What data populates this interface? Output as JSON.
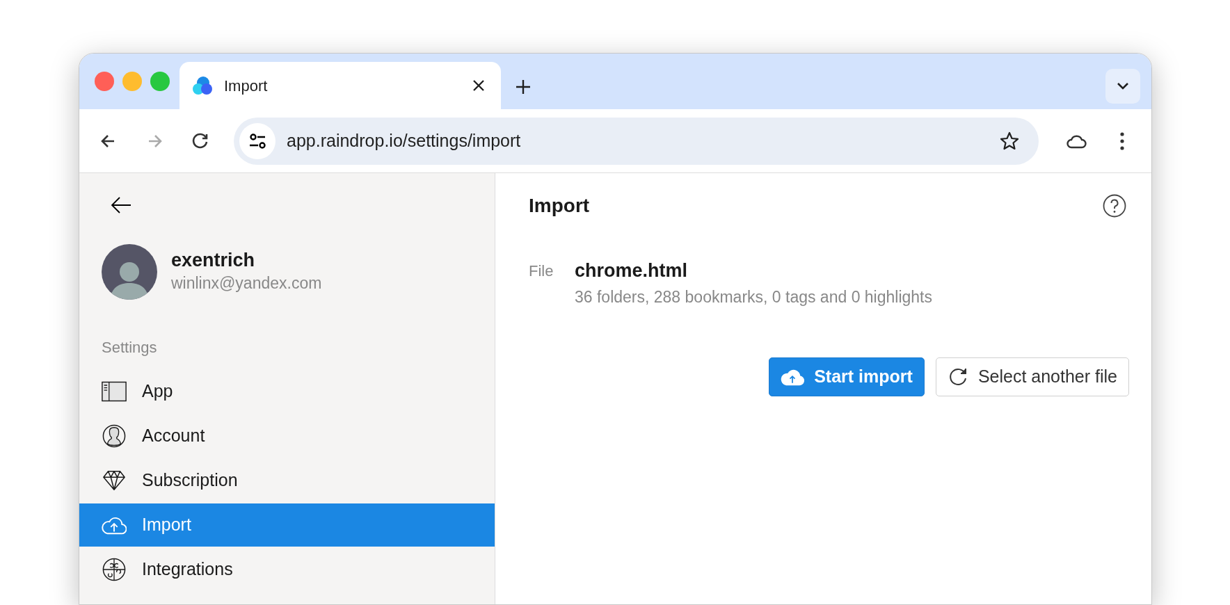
{
  "browser": {
    "tabs": [
      {
        "title": "Import",
        "selected": true
      }
    ],
    "nav_buttons": [
      {
        "kind": "back",
        "disabled": false
      },
      {
        "kind": "forward",
        "disabled": true
      },
      {
        "kind": "reload",
        "disabled": false
      }
    ],
    "address_bar": {
      "url": "app.raindrop.io/settings/import"
    }
  },
  "sidebar": {
    "user": {
      "name": "exentrich",
      "email": "winlinx@yandex.com"
    },
    "section_label": "Settings",
    "items": [
      {
        "kind": "app",
        "label": "App",
        "selected": false
      },
      {
        "kind": "account",
        "label": "Account",
        "selected": false
      },
      {
        "kind": "subscription",
        "label": "Subscription",
        "selected": false
      },
      {
        "kind": "import",
        "label": "Import",
        "selected": true
      },
      {
        "kind": "integrations",
        "label": "Integrations",
        "selected": false
      }
    ]
  },
  "content": {
    "title": "Import",
    "file": {
      "label": "File",
      "name": "chrome.html",
      "summary": "36 folders, 288 bookmarks, 0 tags and 0 highlights"
    },
    "buttons": [
      {
        "kind": "primary",
        "label": "Start import"
      },
      {
        "kind": "secondary",
        "label": "Select another file"
      }
    ]
  }
}
